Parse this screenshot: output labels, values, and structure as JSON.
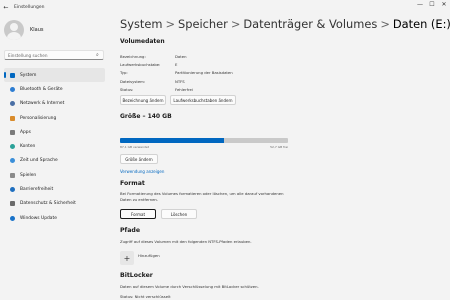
{
  "window": {
    "title": "Einstellungen",
    "back_icon": "arrow-left-icon",
    "controls": [
      "minimize",
      "maximize",
      "close"
    ]
  },
  "sidebar": {
    "user_name": "Klaus",
    "search_placeholder": "Einstellung suchen",
    "items": [
      {
        "label": "System",
        "icon": "system-icon",
        "color": "#0067c0",
        "active": true
      },
      {
        "label": "Bluetooth & Geräte",
        "icon": "bluetooth-icon",
        "color": "#2d7dd2",
        "active": false
      },
      {
        "label": "Netzwerk & Internet",
        "icon": "network-icon",
        "color": "#4a6fa5",
        "active": false
      },
      {
        "label": "Personalisierung",
        "icon": "brush-icon",
        "color": "#d98b2b",
        "active": false
      },
      {
        "label": "Apps",
        "icon": "apps-icon",
        "color": "#7a7a7a",
        "active": false
      },
      {
        "label": "Konten",
        "icon": "account-icon",
        "color": "#2aa198",
        "active": false
      },
      {
        "label": "Zeit und Sprache",
        "icon": "clock-globe-icon",
        "color": "#3b8fd9",
        "active": false
      },
      {
        "label": "Spielen",
        "icon": "gamepad-icon",
        "color": "#8a8a8a",
        "active": false
      },
      {
        "label": "Barrierefreiheit",
        "icon": "accessibility-icon",
        "color": "#1f6fbf",
        "active": false
      },
      {
        "label": "Datenschutz & Sicherheit",
        "icon": "shield-icon",
        "color": "#6b6b6b",
        "active": false
      },
      {
        "label": "Windows Update",
        "icon": "update-icon",
        "color": "#1a73c9",
        "active": false
      }
    ]
  },
  "breadcrumb": {
    "items": [
      "System",
      "Speicher",
      "Datenträger & Volumes"
    ],
    "current": "Daten (E:)",
    "separator": ">"
  },
  "volumedaten": {
    "heading": "Volumedaten",
    "properties": [
      {
        "key": "Bezeichnung:",
        "value": "Daten"
      },
      {
        "key": "Laufwerksbuchstabe:",
        "value": "E"
      },
      {
        "key": "Typ:",
        "value": "Partitionierung der Basisdaten"
      },
      {
        "key": "Dateisystem:",
        "value": "NTFS"
      },
      {
        "key": "Status:",
        "value": "Fehlerfrei"
      }
    ],
    "rename_button": "Bezeichnung ändern",
    "change_letter_button": "Laufwerksbuchstaben ändern"
  },
  "size": {
    "heading": "Größe – 140 GB",
    "used_fraction": 0.62,
    "used_label": "87,1 GB verwendet",
    "free_label": "52,7 GB frei",
    "resize_button": "Größe ändern",
    "usage_link": "Verwendung anzeigen"
  },
  "format": {
    "heading": "Format",
    "description": "Bei Formatierung des Volumes formatieren oder löschen, um alle darauf vorhandenen Daten zu entfernen.",
    "format_button": "Format",
    "delete_button": "Löschen"
  },
  "paths": {
    "heading": "Pfade",
    "description": "Zugriff auf dieses Volumen mit den folgenden NTFS-Pfaden erlauben.",
    "add_label": "Hinzufügen",
    "add_icon": "plus-icon"
  },
  "bitlocker": {
    "heading": "BitLocker",
    "description": "Daten auf diesem Volume durch Verschlüsselung mit BitLocker schützen.",
    "status": "Status: Nicht verschlüsselt"
  }
}
